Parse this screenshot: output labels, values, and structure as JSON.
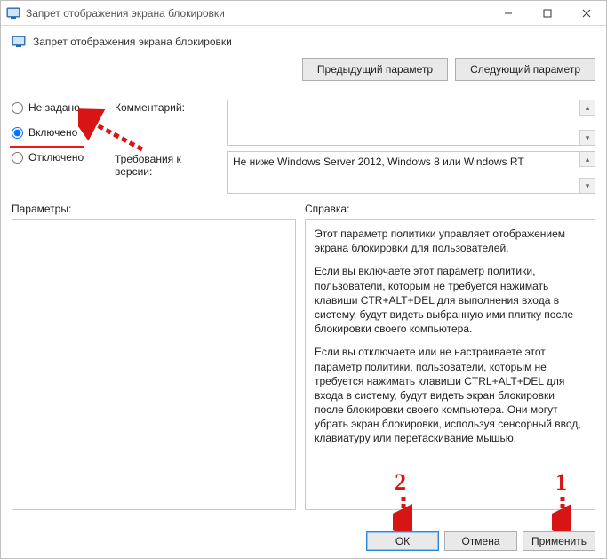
{
  "window": {
    "title": "Запрет отображения экрана блокировки"
  },
  "header": {
    "policy_name": "Запрет отображения экрана блокировки"
  },
  "nav": {
    "prev": "Предыдущий параметр",
    "next": "Следующий параметр"
  },
  "state": {
    "options": {
      "not_configured": "Не задано",
      "enabled": "Включено",
      "disabled": "Отключено"
    },
    "selected": "enabled"
  },
  "labels": {
    "comment": "Комментарий:",
    "requirements": "Требования к версии:",
    "parameters": "Параметры:",
    "help": "Справка:"
  },
  "fields": {
    "comment": "",
    "requirements": "Не ниже Windows Server 2012, Windows 8 или Windows RT"
  },
  "help": {
    "p1": "Этот параметр политики управляет отображением экрана блокировки для пользователей.",
    "p2": "Если вы включаете этот параметр политики, пользователи, которым не требуется нажимать клавиши CTR+ALT+DEL для выполнения входа в систему, будут видеть выбранную ими плитку после блокировки своего компьютера.",
    "p3": "Если вы отключаете или не настраиваете этот параметр политики, пользователи, которым не требуется нажимать клавиши CTRL+ALT+DEL для входа в систему, будут видеть экран блокировки после блокировки своего компьютера. Они могут убрать экран блокировки, используя сенсорный ввод, клавиатуру или перетаскивание мышью."
  },
  "footer": {
    "ok": "ОК",
    "cancel": "Отмена",
    "apply": "Применить"
  },
  "annotations": {
    "one": "1",
    "two": "2"
  }
}
